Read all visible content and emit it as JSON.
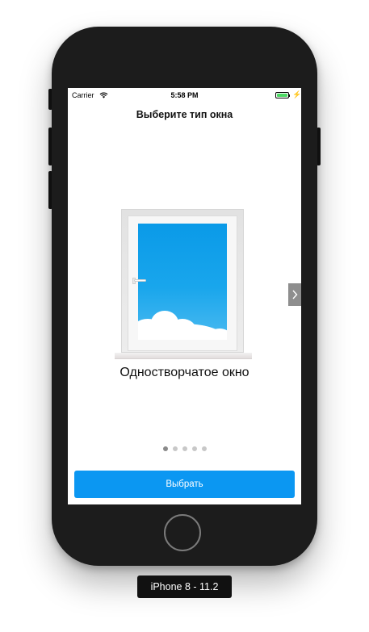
{
  "status_bar": {
    "carrier": "Carrier",
    "time": "5:58 PM",
    "wifi_icon": "wifi-icon",
    "battery_icon": "battery-icon",
    "battery_color": "#4cd964",
    "charging_icon": "bolt-icon",
    "charging_glyph": "⚡"
  },
  "nav": {
    "title": "Выберите тип окна"
  },
  "carousel": {
    "caption": "Одностворчатое окно",
    "next_icon": "chevron-right-icon",
    "next_glyph": "›",
    "page_count": 5,
    "current_page": 1
  },
  "select_button": {
    "label": "Выбрать",
    "color": "#0b97f2"
  },
  "simulator": {
    "device_label": "iPhone 8 - 11.2"
  }
}
